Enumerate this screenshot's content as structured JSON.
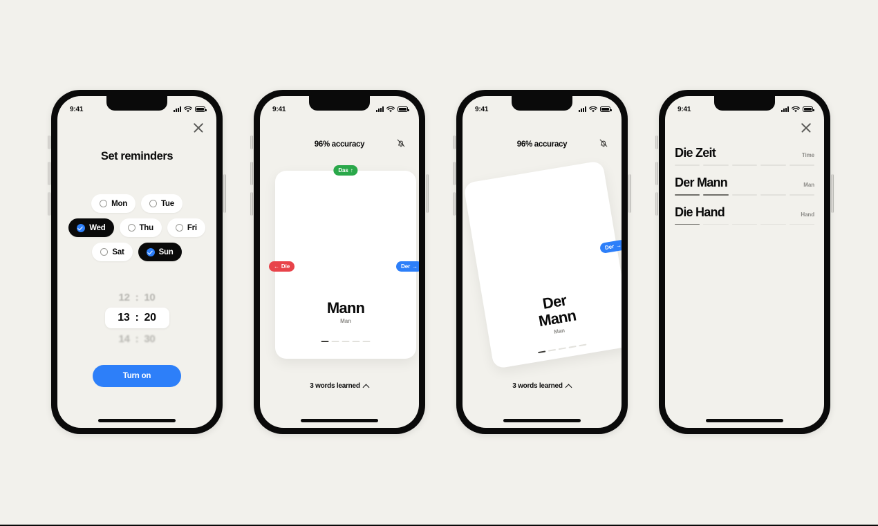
{
  "page": {
    "background": "#f2f1ec"
  },
  "colors": {
    "accent_blue": "#2d7ff9",
    "green": "#2aa84a",
    "red": "#e8434a",
    "ink": "#0a0a0a",
    "muted": "#8d8c88"
  },
  "status_bar": {
    "time": "9:41",
    "signal": "signal-bars-icon",
    "wifi": "wifi-icon",
    "battery": "battery-icon"
  },
  "phones": [
    {
      "id": "set-reminders",
      "close_icon": "close-icon",
      "title": "Set reminders",
      "days": [
        [
          {
            "label": "Mon",
            "selected": false
          },
          {
            "label": "Tue",
            "selected": false
          }
        ],
        [
          {
            "label": "Wed",
            "selected": true
          },
          {
            "label": "Thu",
            "selected": false
          },
          {
            "label": "Fri",
            "selected": false
          }
        ],
        [
          {
            "label": "Sat",
            "selected": false
          },
          {
            "label": "Sun",
            "selected": true
          }
        ]
      ],
      "time_picker": {
        "above": {
          "hour": "12",
          "sep": ":",
          "minute": "10"
        },
        "selected": {
          "hour": "13",
          "sep": ":",
          "minute": "20"
        },
        "below": {
          "hour": "14",
          "sep": ":",
          "minute": "30"
        }
      },
      "cta_label": "Turn on"
    },
    {
      "id": "flashcard-front",
      "accuracy": "96% accuracy",
      "bell_icon": "bell-slash-icon",
      "card": {
        "word": "Mann",
        "translation": "Man",
        "segments_total": 5,
        "segments_filled": 1,
        "tilted": false
      },
      "badges": {
        "up": {
          "label": "Das",
          "arrow": "↑",
          "color": "#2aa84a"
        },
        "left": {
          "arrow": "←",
          "label": "Die",
          "color": "#e8434a"
        },
        "right": {
          "label": "Der",
          "arrow": "→",
          "color": "#2d7ff9"
        }
      },
      "footer": {
        "label": "3 words learned",
        "chevron": "chevron-up-icon"
      }
    },
    {
      "id": "flashcard-swiping",
      "accuracy": "96% accuracy",
      "bell_icon": "bell-slash-icon",
      "card": {
        "word_line1": "Der",
        "word_line2": "Mann",
        "translation": "Man",
        "segments_total": 5,
        "segments_filled": 1,
        "tilted": true
      },
      "badges": {
        "right": {
          "label": "Der",
          "arrow": "→",
          "color": "#2d7ff9"
        }
      },
      "footer": {
        "label": "3 words learned",
        "chevron": "chevron-up-icon"
      }
    },
    {
      "id": "word-list",
      "close_icon": "close-icon",
      "words": [
        {
          "word": "Die Zeit",
          "translation": "Time",
          "segments_total": 5,
          "segments_filled": 0
        },
        {
          "word": "Der Mann",
          "translation": "Man",
          "segments_total": 5,
          "segments_filled": 2
        },
        {
          "word": "Die Hand",
          "translation": "Hand",
          "segments_total": 5,
          "segments_filled": 1
        }
      ]
    }
  ]
}
